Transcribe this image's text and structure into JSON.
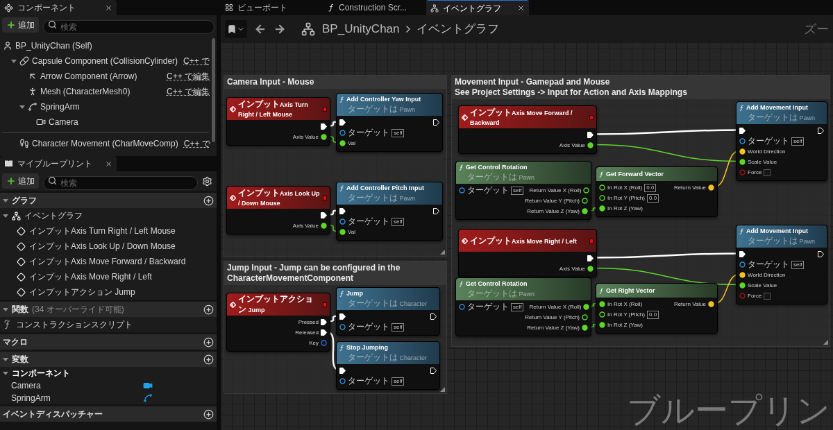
{
  "components_panel": {
    "title": "コンポーネント",
    "add_button": "追加",
    "search": {
      "placeholder": "検索"
    },
    "tree": [
      {
        "label": "BP_UnityChan (Self)",
        "kind": "actor",
        "children": [
          {
            "label": "Capsule Component (CollisionCylinder)",
            "kind": "capsule",
            "edit_link": "C++ で",
            "expanded": true,
            "children": [
              {
                "label": "Arrow Component (Arrow)",
                "kind": "arrow",
                "edit_link": "C++ で編集"
              },
              {
                "label": "Mesh (CharacterMesh0)",
                "kind": "mesh",
                "edit_link": "C++ で編集"
              },
              {
                "label": "SpringArm",
                "kind": "spring_arm",
                "expanded": true,
                "children": [
                  {
                    "label": "Camera",
                    "kind": "camera"
                  }
                ]
              }
            ]
          }
        ]
      }
    ],
    "movement_row": {
      "label": "Character Movement (CharMoveComp)",
      "kind": "movement",
      "edit_link": "C++ で"
    }
  },
  "my_blueprint": {
    "title": "マイブループリント",
    "add_button": "追加",
    "search": {
      "placeholder": "検索"
    },
    "sections": [
      {
        "title": "グラフ",
        "expanded": true,
        "items": [
          {
            "label": "イベントグラフ",
            "kind": "graph",
            "expanded": true,
            "children": [
              {
                "label": "インプットAxis Turn Right / Left Mouse",
                "kind": "event"
              },
              {
                "label": "インプットAxis Look Up / Down Mouse",
                "kind": "event"
              },
              {
                "label": "インプットAxis Move Forward / Backward",
                "kind": "event"
              },
              {
                "label": "インプットAxis Move Right / Left",
                "kind": "event"
              },
              {
                "label": "インプットアクション Jump",
                "kind": "event"
              }
            ]
          }
        ]
      },
      {
        "title": "関数",
        "note": "(34 オーバーライド可能)",
        "expanded": true,
        "items": [
          {
            "label": "コンストラクションスクリプト",
            "kind": "function"
          }
        ]
      },
      {
        "title": "マクロ"
      },
      {
        "title": "変数",
        "expanded": true,
        "items": [
          {
            "label": "コンポーネント",
            "kind": "category",
            "expanded": true,
            "children": [
              {
                "label": "Camera",
                "kind": "camera_var"
              },
              {
                "label": "SpringArm",
                "kind": "spring_arm_var"
              }
            ]
          }
        ]
      },
      {
        "title": "イベントディスパッチャー"
      }
    ]
  },
  "editor_tabs": [
    {
      "label": "ビューポート",
      "kind": "viewport",
      "selected": false
    },
    {
      "label": "Construction Scr...",
      "kind": "function",
      "selected": false
    },
    {
      "label": "イベントグラフ",
      "kind": "graph",
      "selected": true
    }
  ],
  "breadcrumb": [
    "BP_UnityChan",
    "イベントグラフ"
  ],
  "zoom_label": "ズー",
  "graph_type_label": "ブループリン",
  "graph": {
    "comments": [
      {
        "title": "Camera Input - Mouse"
      },
      {
        "title": "Movement Input - Gamepad and Mouse\nSee Project Settings -> Input for Action and Axis Mappings"
      },
      {
        "title": "Jump Input - Jump can be configured in the CharacterMovementComponent"
      }
    ],
    "nodes": [
      {
        "kind": "event",
        "title": "インプットAxis Turn Right / Left Mouse",
        "outputs": [
          {
            "kind": "exec",
            "connected": true
          },
          {
            "label": "Axis Value",
            "kind": "float",
            "connected": true
          }
        ]
      },
      {
        "kind": "function",
        "title": "Add Controller Yaw Input",
        "subtitle": "ターゲットは Pawn",
        "inputs": [
          {
            "kind": "exec",
            "connected": true
          },
          {
            "label": "ターゲット",
            "kind": "object",
            "connected": false,
            "value": "self"
          },
          {
            "label": "Val",
            "kind": "float",
            "connected": true
          }
        ],
        "outputs": [
          {
            "kind": "exec",
            "connected": false
          }
        ]
      },
      {
        "kind": "event",
        "title": "インプットAxis Look Up / Down Mouse",
        "outputs": [
          {
            "kind": "exec",
            "connected": true
          },
          {
            "label": "Axis Value",
            "kind": "float",
            "connected": true
          }
        ]
      },
      {
        "kind": "function",
        "title": "Add Controller Pitch Input",
        "subtitle": "ターゲットは Pawn",
        "inputs": [
          {
            "kind": "exec",
            "connected": true
          },
          {
            "label": "ターゲット",
            "kind": "object",
            "connected": false,
            "value": "self"
          },
          {
            "label": "Val",
            "kind": "float",
            "connected": true
          }
        ],
        "outputs": [
          {
            "kind": "exec",
            "connected": false
          }
        ]
      },
      {
        "kind": "event",
        "title": "インプットAxis Move Forward / Backward",
        "outputs": [
          {
            "kind": "exec",
            "connected": true
          },
          {
            "label": "Axis Value",
            "kind": "float",
            "connected": true
          }
        ]
      },
      {
        "kind": "function",
        "title": "Add Movement Input",
        "subtitle": "ターゲットは Pawn",
        "inputs": [
          {
            "kind": "exec",
            "connected": true
          },
          {
            "label": "ターゲット",
            "kind": "object",
            "connected": false,
            "value": "self"
          },
          {
            "label": "World Direction",
            "kind": "vector",
            "connected": true
          },
          {
            "label": "Scale Value",
            "kind": "float",
            "connected": true
          },
          {
            "label": "Force",
            "kind": "bool",
            "connected": false,
            "checked": false
          }
        ],
        "outputs": [
          {
            "kind": "exec",
            "connected": false
          }
        ]
      },
      {
        "kind": "pure",
        "title": "Get Control Rotation",
        "subtitle": "ターゲットは Pawn",
        "inputs": [
          {
            "label": "ターゲット",
            "kind": "object",
            "connected": false,
            "value": "self"
          }
        ],
        "outputs": [
          {
            "label": "Return Value X (Roll)",
            "kind": "float",
            "connected": false
          },
          {
            "label": "Return Value Y (Pitch)",
            "kind": "float",
            "connected": false
          },
          {
            "label": "Return Value Z (Yaw)",
            "kind": "float",
            "connected": true
          }
        ]
      },
      {
        "kind": "pure",
        "title": "Get Forward Vector",
        "inputs": [
          {
            "label": "In Rot X (Roll)",
            "kind": "float",
            "connected": false,
            "value": "0.0"
          },
          {
            "label": "In Rot Y (Pitch)",
            "kind": "float",
            "connected": false,
            "value": "0.0"
          },
          {
            "label": "In Rot Z (Yaw)",
            "kind": "float",
            "connected": true
          }
        ],
        "outputs": [
          {
            "label": "Return Value",
            "kind": "vector",
            "connected": true
          }
        ]
      },
      {
        "kind": "event",
        "title": "インプットAxis Move Right / Left",
        "outputs": [
          {
            "kind": "exec",
            "connected": true
          },
          {
            "label": "Axis Value",
            "kind": "float",
            "connected": true
          }
        ]
      },
      {
        "kind": "function",
        "title": "Add Movement Input",
        "subtitle": "ターゲットは Pawn",
        "inputs": [
          {
            "kind": "exec",
            "connected": true
          },
          {
            "label": "ターゲット",
            "kind": "object",
            "connected": false,
            "value": "self"
          },
          {
            "label": "World Direction",
            "kind": "vector",
            "connected": true
          },
          {
            "label": "Scale Value",
            "kind": "float",
            "connected": true
          },
          {
            "label": "Force",
            "kind": "bool",
            "connected": false,
            "checked": false
          }
        ],
        "outputs": [
          {
            "kind": "exec",
            "connected": false
          }
        ]
      },
      {
        "kind": "pure",
        "title": "Get Control Rotation",
        "subtitle": "ターゲットは Pawn",
        "inputs": [
          {
            "label": "ターゲット",
            "kind": "object",
            "connected": false,
            "value": "self"
          }
        ],
        "outputs": [
          {
            "label": "Return Value X (Roll)",
            "kind": "float",
            "connected": true
          },
          {
            "label": "Return Value Y (Pitch)",
            "kind": "float",
            "connected": false
          },
          {
            "label": "Return Value Z (Yaw)",
            "kind": "float",
            "connected": true
          }
        ]
      },
      {
        "kind": "pure",
        "title": "Get Right Vector",
        "inputs": [
          {
            "label": "In Rot X (Roll)",
            "kind": "float",
            "connected": true
          },
          {
            "label": "In Rot Y (Pitch)",
            "kind": "float",
            "connected": false,
            "value": "0.0"
          },
          {
            "label": "In Rot Z (Yaw)",
            "kind": "float",
            "connected": true
          }
        ],
        "outputs": [
          {
            "label": "Return Value",
            "kind": "vector",
            "connected": true
          }
        ]
      },
      {
        "kind": "event",
        "title": "インプットアクション Jump",
        "outputs": [
          {
            "label": "Pressed",
            "kind": "exec",
            "connected": true
          },
          {
            "label": "Released",
            "kind": "exec",
            "connected": true
          },
          {
            "label": "Key",
            "kind": "struct",
            "connected": false
          }
        ]
      },
      {
        "kind": "function",
        "title": "Jump",
        "subtitle": "ターゲットは Character",
        "inputs": [
          {
            "kind": "exec",
            "connected": true
          },
          {
            "label": "ターゲット",
            "kind": "object",
            "connected": false,
            "value": "self"
          }
        ],
        "outputs": [
          {
            "kind": "exec",
            "connected": false
          }
        ]
      },
      {
        "kind": "function",
        "title": "Stop Jumping",
        "subtitle": "ターゲットは Character",
        "inputs": [
          {
            "kind": "exec",
            "connected": true
          },
          {
            "label": "ターゲット",
            "kind": "object",
            "connected": false,
            "value": "self"
          }
        ],
        "outputs": [
          {
            "kind": "exec",
            "connected": false
          }
        ]
      }
    ]
  }
}
